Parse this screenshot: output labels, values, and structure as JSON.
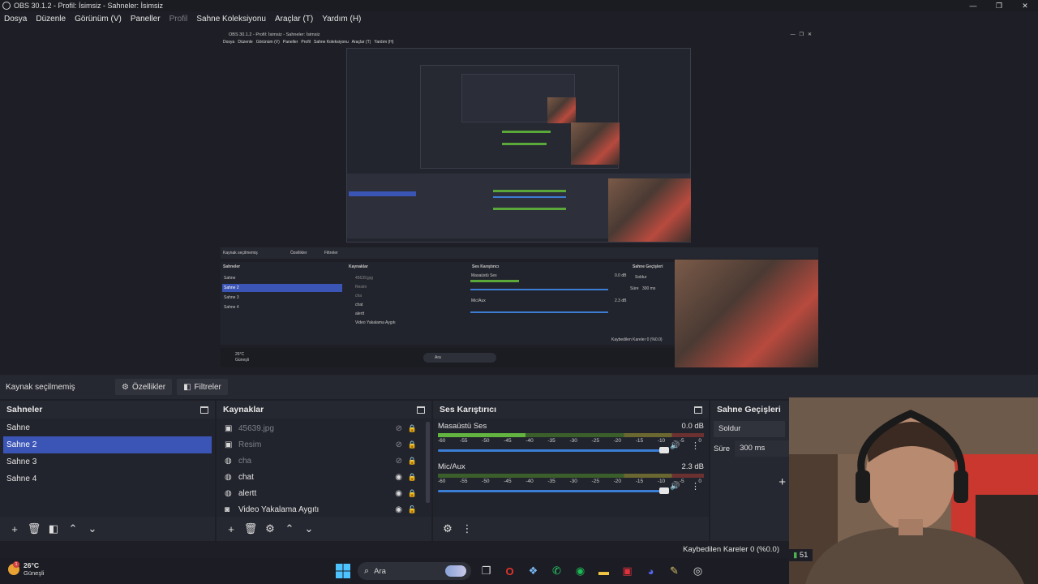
{
  "window": {
    "title": "OBS 30.1.2 - Profil: İsimsiz - Sahneler: İsimsiz",
    "controls": [
      "—",
      "❐",
      "✕"
    ]
  },
  "menu": [
    {
      "label": "Dosya",
      "dim": false
    },
    {
      "label": "Düzenle",
      "dim": false
    },
    {
      "label": "Görünüm (V)",
      "dim": false
    },
    {
      "label": "Paneller",
      "dim": false
    },
    {
      "label": "Profil",
      "dim": true
    },
    {
      "label": "Sahne Koleksiyonu",
      "dim": false
    },
    {
      "label": "Araçlar (T)",
      "dim": false
    },
    {
      "label": "Yardım (H)",
      "dim": false
    }
  ],
  "source_toolbar": {
    "no_source": "Kaynak seçilmemiş",
    "properties": "Özellikler",
    "filters": "Filtreler"
  },
  "scenes": {
    "title": "Sahneler",
    "items": [
      {
        "label": "Sahne",
        "selected": false
      },
      {
        "label": "Sahne 2",
        "selected": true
      },
      {
        "label": "Sahne 3",
        "selected": false
      },
      {
        "label": "Sahne 4",
        "selected": false
      }
    ]
  },
  "sources": {
    "title": "Kaynaklar",
    "items": [
      {
        "label": "45639.jpg",
        "icon": "image-icon",
        "visible": false
      },
      {
        "label": "Resim",
        "icon": "image-icon",
        "visible": false
      },
      {
        "label": "cha",
        "icon": "globe-icon",
        "visible": false
      },
      {
        "label": "chat",
        "icon": "globe-icon",
        "visible": true
      },
      {
        "label": "alertt",
        "icon": "globe-icon",
        "visible": true
      },
      {
        "label": "Video Yakalama Aygıtı",
        "icon": "camera-icon",
        "visible": true
      }
    ]
  },
  "mixer": {
    "title": "Ses Karıştırıcı",
    "channels": [
      {
        "name": "Masaüstü Ses",
        "db": "0.0 dB",
        "level": 0.33
      },
      {
        "name": "Mic/Aux",
        "db": "2.3 dB",
        "level": 0.0
      }
    ],
    "ticks": [
      "-60",
      "-55",
      "-50",
      "-45",
      "-40",
      "-35",
      "-30",
      "-25",
      "-20",
      "-15",
      "-10",
      "-5",
      "0"
    ]
  },
  "transitions": {
    "title": "Sahne Geçişleri",
    "type": "Soldur",
    "duration_label": "Süre",
    "duration_value": "300 ms"
  },
  "status": {
    "dropped": "Kaybedilen Kareler 0 (%0.0)",
    "partial": "51"
  },
  "taskbar": {
    "temp": "26°C",
    "condition": "Güneşli",
    "search": "Ara"
  },
  "nested": {
    "title": "OBS 30.1.2 - Profil: İsimsiz - Sahneler: İsimsiz",
    "no_source": "Kaynak seçilmemiş",
    "properties": "Özellikler",
    "filters": "Filtreler",
    "scenes_title": "Sahneler",
    "sources_title": "Kaynaklar",
    "mixer_title": "Ses Karıştırıcı",
    "trans_title": "Sahne Geçişleri",
    "scene_items": [
      "Sahne",
      "Sahne 2",
      "Sahne 3",
      "Sahne 4"
    ],
    "source_items": [
      "45639.jpg",
      "Resim",
      "cha",
      "chat",
      "alertt",
      "Video Yakalama Aygıtı"
    ],
    "mix_ch1": "Masaüstü Ses",
    "mix_ch2": "Mic/Aux",
    "mix_db1": "0.0 dB",
    "mix_db2": "2.3 dB",
    "trans_type": "Soldur",
    "trans_dur_label": "Süre",
    "trans_dur_value": "300 ms",
    "dropped": "Kaybedilen Kareler 0 (%0.0)",
    "temp": "26°C",
    "condition": "Güneşli",
    "search": "Ara"
  }
}
